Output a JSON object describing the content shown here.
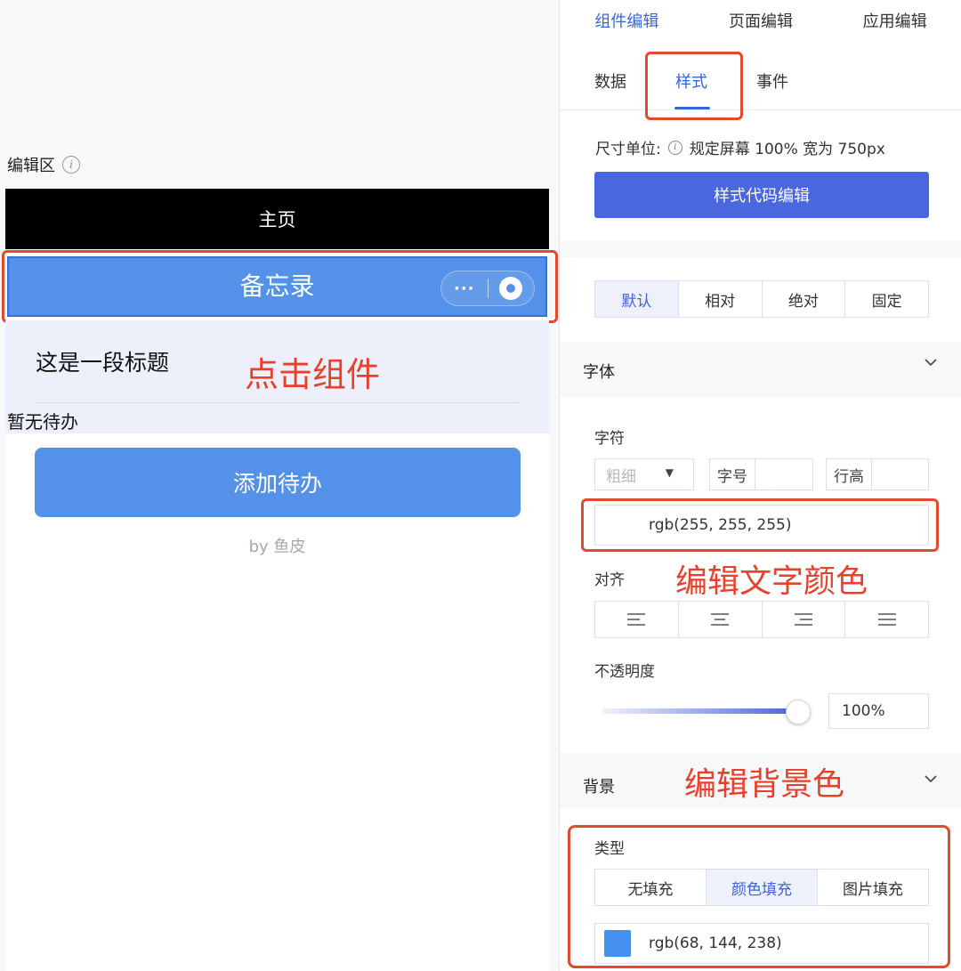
{
  "editor": {
    "label": "编辑区",
    "phone_title": "主页",
    "memo_title": "备忘录",
    "capsule_more": "···",
    "item_title": "这是一段标题",
    "empty_text": "暂无待办",
    "add_button": "添加待办",
    "byline": "by 鱼皮"
  },
  "annotations": {
    "click_component": "点击组件",
    "edit_text_color": "编辑文字颜色",
    "edit_bg_color": "编辑背景色"
  },
  "panel": {
    "top_tabs": [
      "组件编辑",
      "页面编辑",
      "应用编辑"
    ],
    "top_tab_active": "组件编辑",
    "sub_tabs": [
      "数据",
      "样式",
      "事件"
    ],
    "sub_tab_active": "样式",
    "size_unit_label": "尺寸单位:",
    "size_unit_desc": "规定屏幕 100% 宽为 750px",
    "code_edit_button": "样式代码编辑",
    "position_options": [
      "默认",
      "相对",
      "绝对",
      "固定"
    ],
    "position_active": "默认",
    "font_section": "字体",
    "char_label": "字符",
    "weight_placeholder": "粗细",
    "font_size_prefix": "字号",
    "line_height_prefix": "行高",
    "text_color_value": "rgb(255, 255, 255)",
    "align_label": "对齐",
    "align_options": [
      "align-left",
      "align-center",
      "align-right",
      "align-justify"
    ],
    "opacity_label": "不透明度",
    "opacity_value": "100%",
    "opacity_level": 1.0,
    "bg_section": "背景",
    "type_label": "类型",
    "fill_options": [
      "无填充",
      "颜色填充",
      "图片填充"
    ],
    "fill_active": "颜色填充",
    "bg_color_value": "rgb(68, 144, 238)",
    "bg_color_hex": "#4490ee"
  },
  "colors": {
    "accent": "#3667d6",
    "primary_button": "#4a67e0",
    "memo_blue": "#5491e8",
    "annotation_red": "#e34a2c"
  }
}
